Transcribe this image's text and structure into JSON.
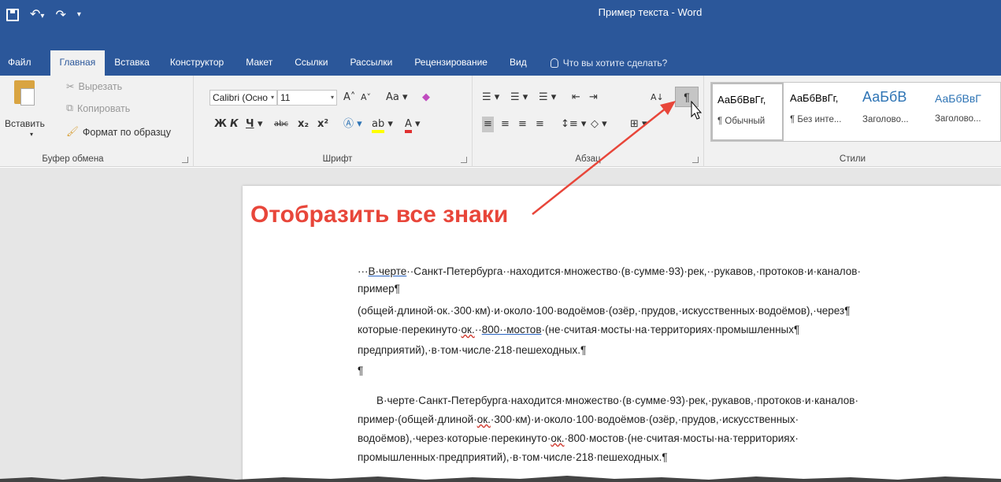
{
  "window": {
    "title": "Пример текста  -  Word"
  },
  "qat": {
    "undo_glyph": "↶",
    "redo_glyph": "↷",
    "dropdown": "▾"
  },
  "tabs": [
    {
      "label": "Файл"
    },
    {
      "label": "Главная",
      "active": true
    },
    {
      "label": "Вставка"
    },
    {
      "label": "Конструктор"
    },
    {
      "label": "Макет"
    },
    {
      "label": "Ссылки"
    },
    {
      "label": "Рассылки"
    },
    {
      "label": "Рецензирование"
    },
    {
      "label": "Вид"
    }
  ],
  "tell_me": "Что вы хотите сделать?",
  "clipboard": {
    "paste": "Вставить",
    "cut": "Вырезать",
    "copy": "Копировать",
    "format_painter": "Формат по образцу",
    "group_label": "Буфер обмена"
  },
  "font": {
    "family": "Calibri (Осно",
    "size": "11",
    "group_label": "Шрифт",
    "bold": "Ж",
    "italic": "К",
    "underline": "Ч",
    "strike": "abc",
    "subscript": "x₂",
    "superscript": "x²",
    "grow": "A˄",
    "shrink": "A˅",
    "case": "Aa",
    "font_color": "A",
    "highlight": "ab"
  },
  "paragraph": {
    "group_label": "Абзац",
    "show_marks": "¶"
  },
  "styles": {
    "group_label": "Стили",
    "items": [
      {
        "sample": "АаБбВвГг,",
        "name": "¶ Обычный",
        "kind": "normal"
      },
      {
        "sample": "АаБбВвГг,",
        "name": "¶ Без инте...",
        "kind": "normal"
      },
      {
        "sample": "АаБбВ",
        "name": "Заголово...",
        "kind": "heading"
      },
      {
        "sample": "АаБбВвГ",
        "name": "Заголово...",
        "kind": "heading2"
      }
    ]
  },
  "callout": "Отобразить все знаки",
  "document": {
    "p1": [
      "···В·черте··Санкт-Петербурга··находится·множество·(в·сумме·93)·рек,··рукавов,·протоков·и·каналов·",
      "пример¶",
      "(общей·длиной·ок.·300·км)·и·около·100·водоёмов·(озёр,·прудов,·искусственных·водоёмов),·через¶",
      "которые·перекинуто·ок.··800··мостов·(не·считая·мосты·на·территориях·промышленных¶",
      "предприятий),·в·том·числе·218·пешеходных.¶",
      "¶"
    ],
    "p2": [
      "В·черте·Санкт-Петербурга·находится·множество·(в·сумме·93)·рек,·рукавов,·протоков·и·каналов·",
      "пример·(общей·длиной·ок.·300·км)·и·около·100·водоёмов·(озёр,·прудов,·искусственных·",
      "водоёмов),·через·которые·перекинуто·ок.·800·мостов·(не·считая·мосты·на·территориях·",
      "промышленных·предприятий),·в·том·числе·218·пешеходных.¶"
    ]
  },
  "colors": {
    "word_blue": "#2b579a",
    "callout_red": "#e8463a"
  }
}
